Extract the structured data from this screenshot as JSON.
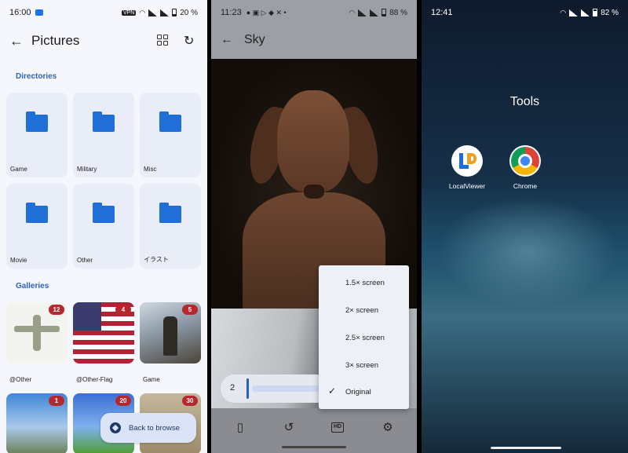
{
  "left_screen": {
    "status": {
      "time": "16:00",
      "vpn": "VPN",
      "battery": "20 %"
    },
    "title": "Pictures",
    "directories_header": "Directories",
    "directories": [
      "Game",
      "Military",
      "Misc",
      "Movie",
      "Other",
      "イラスト"
    ],
    "galleries_header": "Galleries",
    "galleries": [
      {
        "label": "@Other",
        "count": "12"
      },
      {
        "label": "@Other-Flag",
        "count": "4"
      },
      {
        "label": "Game",
        "count": "5"
      },
      {
        "label": "",
        "count": "1"
      },
      {
        "label": "",
        "count": "20"
      },
      {
        "label": "",
        "count": "30"
      }
    ],
    "fab_label": "Back to browse"
  },
  "middle_screen": {
    "status": {
      "time": "11:23",
      "battery": "88 %"
    },
    "title": "Sky",
    "zoom_value": "2",
    "zoom_options": [
      "1.5× screen",
      "2× screen",
      "2.5× screen",
      "3× screen",
      "Original"
    ],
    "selected_option": "Original",
    "hd_label": "HD"
  },
  "right_screen": {
    "status": {
      "time": "12:41",
      "battery": "82 %"
    },
    "folder_title": "Tools",
    "apps": [
      "LocalViewer",
      "Chrome"
    ]
  }
}
